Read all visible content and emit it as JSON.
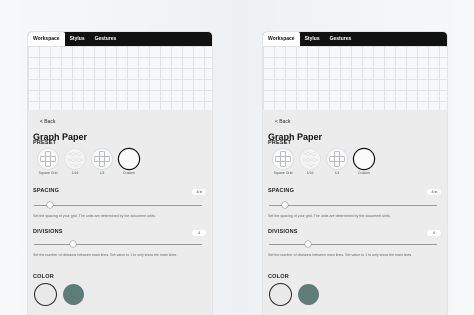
{
  "tabs": [
    "Workspace",
    "Stylus",
    "Gestures"
  ],
  "back_label": "< Back",
  "title": "Graph Paper",
  "preset": {
    "label": "PRESET",
    "options": [
      "Square Grid",
      "1/16",
      "1/4",
      "Custom"
    ],
    "selected": "Custom"
  },
  "spacing": {
    "label": "SPACING",
    "value": ".5 in",
    "help": "Set the spacing of your grid. The units are determined by the document units.",
    "slider_fraction": 0.08
  },
  "divisions": {
    "label": "DIVISIONS",
    "value": "4",
    "help": "Set the number of divisions between main lines. Set value to 1 to only show the main lines.",
    "slider_fraction": 0.22
  },
  "color": {
    "label": "COLOR",
    "swatches": [
      "#e9e9e9",
      "#5e7d79"
    ],
    "selected": "#e9e9e9"
  },
  "colors": {
    "tabbar": "#111111",
    "settings_bg": "#ececec",
    "accent_teal": "#5e7d79"
  }
}
